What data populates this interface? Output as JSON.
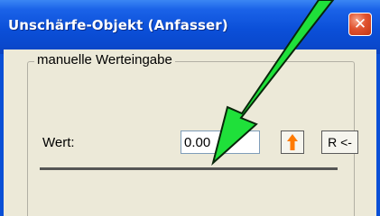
{
  "window": {
    "title": "Unschärfe-Objekt (Anfasser)",
    "close_icon": "close-icon",
    "close_glyph": "✕"
  },
  "group": {
    "legend": "manuelle Werteingabe",
    "wert_label": "Wert:",
    "wert_value": "0.00",
    "up_icon": "arrow-up-icon",
    "r_button_label": "R <-"
  },
  "annotation": {
    "icon": "green-arrow-icon",
    "color": "#1fe03a"
  },
  "colors": {
    "titlebar": "#0b4fd8",
    "dialog_bg": "#ece9d8",
    "close_button": "#e0522e",
    "up_arrow": "#ff7a00"
  }
}
